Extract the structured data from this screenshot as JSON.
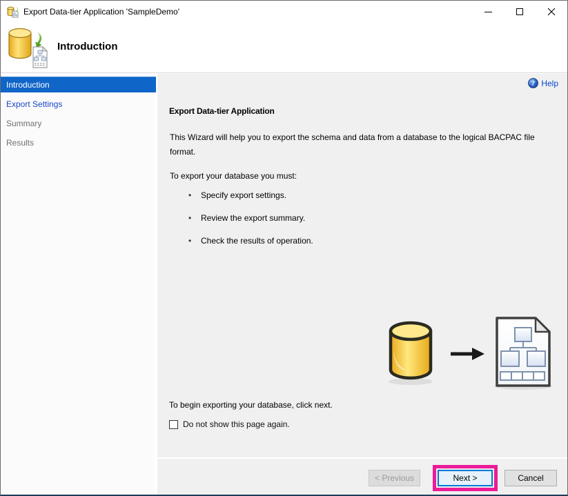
{
  "titlebar": {
    "title": "Export Data-tier Application 'SampleDemo'"
  },
  "header": {
    "title": "Introduction"
  },
  "sidebar": {
    "items": [
      {
        "label": "Introduction",
        "state": "selected"
      },
      {
        "label": "Export Settings",
        "state": "enabled"
      },
      {
        "label": "Summary",
        "state": "pending"
      },
      {
        "label": "Results",
        "state": "pending"
      }
    ]
  },
  "main": {
    "help_label": "Help",
    "heading": "Export Data-tier Application",
    "intro": "This Wizard will help you to export the schema and data from a database to the logical BACPAC file format.",
    "must": "To export your database you must:",
    "bullets": [
      "Specify export settings.",
      "Review the export summary.",
      "Check the results of operation."
    ],
    "begin": "To begin exporting your database, click next.",
    "checkbox_label": "Do not show this page again.",
    "checkbox_checked": false
  },
  "footer": {
    "previous": "< Previous",
    "next": "Next >",
    "cancel": "Cancel"
  },
  "colors": {
    "sidebar_selected_bg": "#1065c8",
    "sidebar_link_text": "#1948c8",
    "help_link_text": "#0a46d2",
    "next_button_border": "#0078d7",
    "annotation_highlight": "#ec1b98",
    "main_background": "#f0f0f0"
  }
}
